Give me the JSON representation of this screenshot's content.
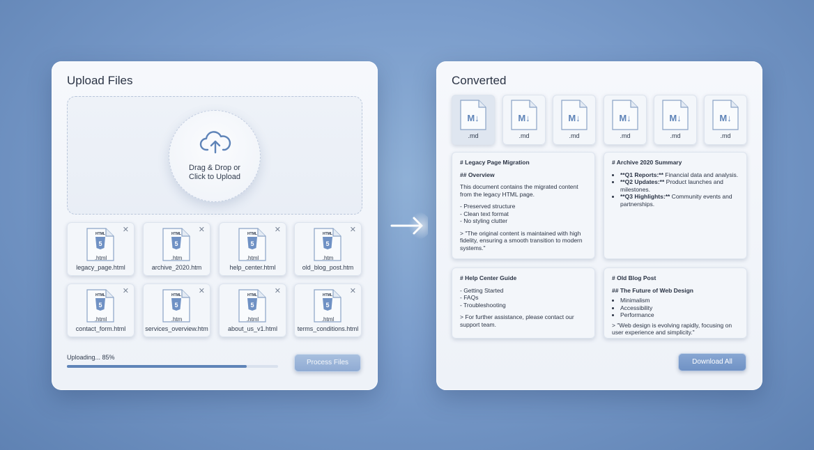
{
  "upload": {
    "title": "Upload Files",
    "drop_text_line1": "Drag & Drop or",
    "drop_text_line2": "Click to Upload",
    "close_glyph": "✕",
    "file_icon_label": "HTML",
    "files": [
      {
        "ext": ".html",
        "name": "legacy_page.html"
      },
      {
        "ext": ".htm",
        "name": "archive_2020.htm"
      },
      {
        "ext": ".html",
        "name": "help_center.html"
      },
      {
        "ext": ".htm",
        "name": "old_blog_post.htm"
      },
      {
        "ext": ".html",
        "name": "contact_form.html"
      },
      {
        "ext": ".htm",
        "name": "services_overview.htm"
      },
      {
        "ext": ".html",
        "name": "about_us_v1.html"
      },
      {
        "ext": ".html",
        "name": "terms_conditions.html"
      }
    ],
    "progress_label": "Uploading... 85%",
    "progress_fraction": 0.85,
    "process_button": "Process Files"
  },
  "converted": {
    "title": "Converted",
    "md_tiles": [
      {
        "ext": ".md",
        "active": true
      },
      {
        "ext": ".md"
      },
      {
        "ext": ".md"
      },
      {
        "ext": ".md"
      },
      {
        "ext": ".md"
      },
      {
        "ext": ".md"
      }
    ],
    "md_badge": "M↓",
    "previews": {
      "p1": {
        "h1": "# Legacy Page Migration",
        "h2": "## Overview",
        "para": "This document contains the migrated content from the legacy HTML page.",
        "list": [
          "- Preserved structure",
          "- Clean text format",
          "- No styling clutter"
        ],
        "quote": "> \"The original content is maintained with high fidelity, ensuring a smooth transition to modern systems.\""
      },
      "p2": {
        "h1": "# Archive 2020 Summary",
        "items": [
          {
            "bold": "**Q1 Reports:**",
            "text": " Financial data and analysis."
          },
          {
            "bold": "**Q2 Updates:**",
            "text": " Product launches and milestones."
          },
          {
            "bold": "**Q3 Highlights:**",
            "text": " Community events and partnerships."
          }
        ]
      },
      "p3": {
        "h1": "# Help Center Guide",
        "list": [
          "- Getting Started",
          "- FAQs",
          "- Troubleshooting"
        ],
        "quote": "> For further assistance, please contact our support team."
      },
      "p4": {
        "h1": "# Old Blog Post",
        "h2": "## The Future of Web Design",
        "items": [
          "Minimalism",
          "Accessibility",
          "Performance"
        ],
        "quote": "> \"Web design is evolving rapidly, focusing on user experience and simplicity.\""
      }
    },
    "download_button": "Download All"
  },
  "colors": {
    "accent": "#5f84b8",
    "background": "#7a9ccb",
    "html_badge": "#6f91c4"
  }
}
